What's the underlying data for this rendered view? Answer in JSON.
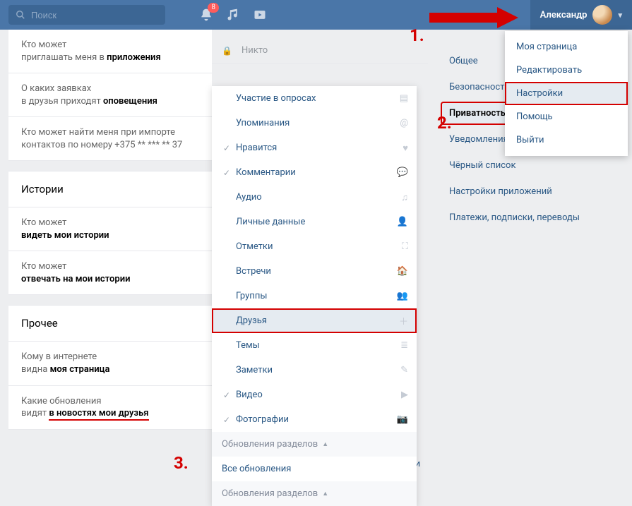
{
  "header": {
    "search_placeholder": "Поиск",
    "notification_count": "8",
    "profile_name": "Александр"
  },
  "profile_menu": {
    "items": [
      {
        "label": "Моя страница"
      },
      {
        "label": "Редактировать"
      },
      {
        "label": "Настройки",
        "highlight": true
      },
      {
        "label": "Помощь"
      },
      {
        "label": "Выйти"
      }
    ]
  },
  "annotations": {
    "step1": "1.",
    "step2": "2.",
    "step3": "3."
  },
  "left": {
    "group0": {
      "row0_a": "Кто может",
      "row0_b": "приглашать меня в ",
      "row0_c": "приложения",
      "row1_a": "О каких заявках",
      "row1_b": "в друзья приходят ",
      "row1_c": "оповещения",
      "row2": "Кто может найти меня при импорте контактов по номеру +375 ** *** ** 37"
    },
    "group1_title": "Истории",
    "group1_row0_a": "Кто может",
    "group1_row0_b": "видеть мои истории",
    "group1_row1_a": "Кто может",
    "group1_row1_b": "отвечать на мои истории",
    "group2_title": "Прочее",
    "group2_row0_a": "Кому в интернете",
    "group2_row0_b": "видна ",
    "group2_row0_c": "моя страница",
    "group2_row1_a": "Какие обновления",
    "group2_row1_b": "видят ",
    "group2_row1_c": "в новостях мои друзья"
  },
  "mid": {
    "header_lock_label": "Никто",
    "items": [
      {
        "label": "Участие в опросах",
        "rightIcon": "bars"
      },
      {
        "label": "Упоминания",
        "rightIcon": "at"
      },
      {
        "label": "Нравится",
        "checked": true,
        "rightIcon": "heart"
      },
      {
        "label": "Комментарии",
        "checked": true,
        "rightIcon": "comment"
      },
      {
        "label": "Аудио",
        "rightIcon": "music"
      },
      {
        "label": "Личные данные",
        "rightIcon": "person"
      },
      {
        "label": "Отметки",
        "rightIcon": "expand"
      },
      {
        "label": "Встречи",
        "rightIcon": "building"
      },
      {
        "label": "Группы",
        "rightIcon": "group"
      },
      {
        "label": "Друзья",
        "selected": true,
        "rightIcon": "plus"
      },
      {
        "label": "Темы",
        "rightIcon": "list"
      },
      {
        "label": "Заметки",
        "rightIcon": "note"
      },
      {
        "label": "Видео",
        "checked": true,
        "rightIcon": "play"
      },
      {
        "label": "Фотографии",
        "checked": true,
        "rightIcon": "camera"
      }
    ],
    "footer_a": "Обновления разделов",
    "footer_b": "Все обновления",
    "footer_c": "Обновления разделов"
  },
  "tags": {
    "a": "Фотографии",
    "b": "Нравится",
    "c": "Комментарии"
  },
  "side_nav": {
    "items": [
      {
        "label": "Общее"
      },
      {
        "label": "Безопасность"
      },
      {
        "label": "Приватность",
        "active": true
      },
      {
        "label": "Уведомления"
      },
      {
        "label": "Чёрный список"
      },
      {
        "label": "Настройки приложений"
      },
      {
        "label": "Платежи, подписки, переводы"
      }
    ]
  }
}
